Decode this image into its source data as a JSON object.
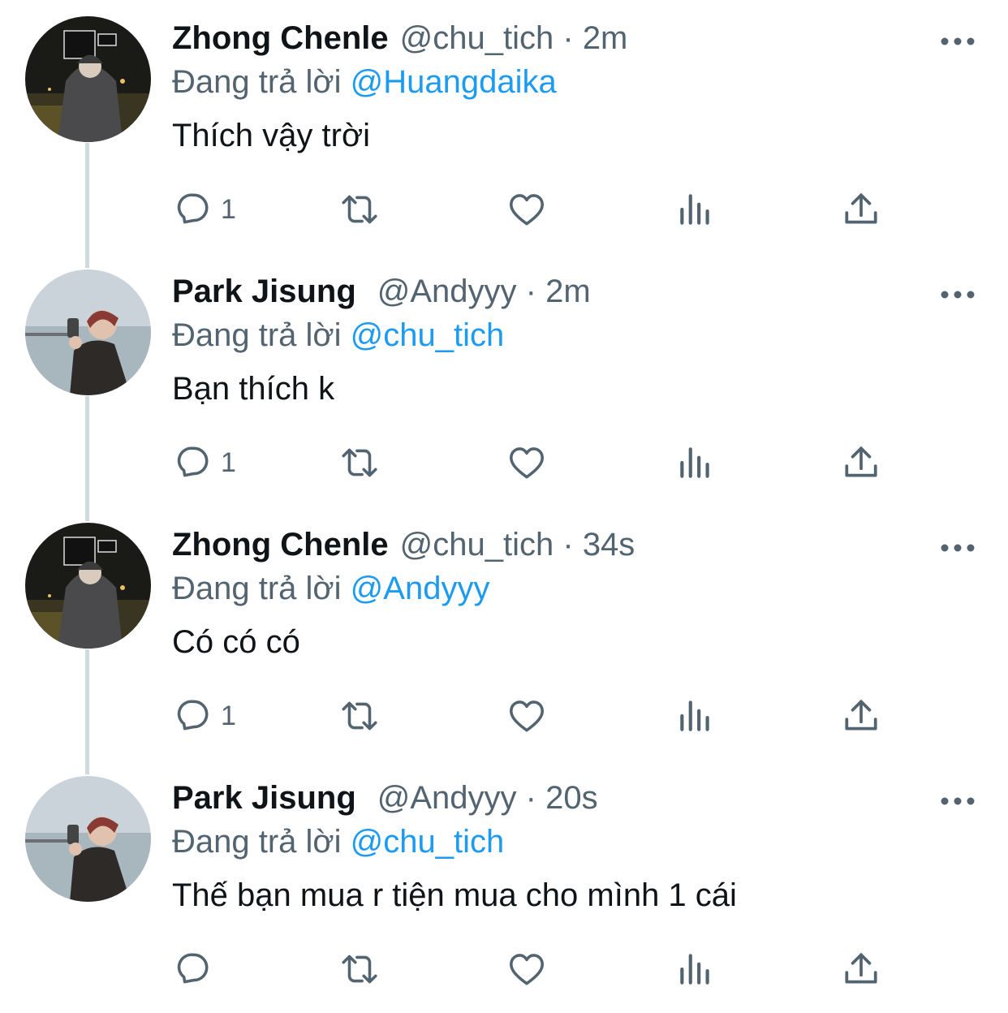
{
  "reply_prefix": "Đang trả lời",
  "colors": {
    "link": "#1d9bf0",
    "secondary": "#536471",
    "text": "#0f1419",
    "thread": "#cfd9de"
  },
  "tweets": [
    {
      "name": "Zhong Chenle",
      "handle": "@chu_tich",
      "dot": "·",
      "time": "2m",
      "reply_to": "@Huangdaika",
      "text": "Thích vậy trời",
      "reply_count": "1",
      "avatar": "night-street-photo"
    },
    {
      "name": "Park Jisung",
      "handle": "@Andyyy",
      "dot": "·",
      "time": "2m",
      "reply_to": "@chu_tich",
      "text": "Bạn thích k",
      "reply_count": "1",
      "avatar": "seaside-photo"
    },
    {
      "name": "Zhong Chenle",
      "handle": "@chu_tich",
      "dot": "·",
      "time": "34s",
      "reply_to": "@Andyyy",
      "text": "Có có có",
      "reply_count": "1",
      "avatar": "night-street-photo"
    },
    {
      "name": "Park Jisung",
      "handle": "@Andyyy",
      "dot": "·",
      "time": "20s",
      "reply_to": "@chu_tich",
      "text": "Thế bạn mua r tiện mua cho mình 1 cái",
      "reply_count": "",
      "avatar": "seaside-photo"
    }
  ],
  "icons": [
    "reply-icon",
    "retweet-icon",
    "like-icon",
    "views-icon",
    "share-icon",
    "more-icon"
  ]
}
